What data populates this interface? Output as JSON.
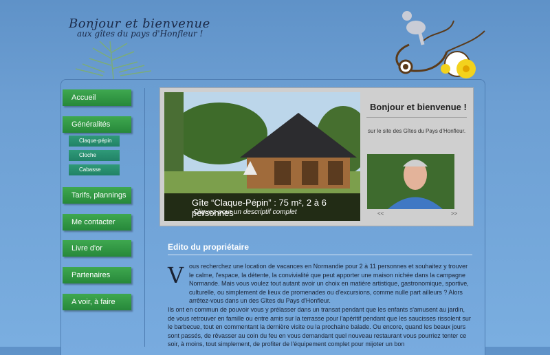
{
  "header": {
    "welcome_line1": "Bonjour et bienvenue",
    "welcome_line2": "aux gîtes du pays d'Honfleur !"
  },
  "nav": {
    "accueil": "Accueil",
    "generalites": "Généralités",
    "sub_items": [
      "Claque-pépin",
      "Cloche",
      "Cabasse"
    ],
    "tarifs": "Tarifs, plannings",
    "contact": "Me contacter",
    "livre": "Livre d'or",
    "partenaires": "Partenaires",
    "voir": "A voir, à faire"
  },
  "slider": {
    "caption_title": "Gîte “Claque-Pépin” : 75 m², 2 à 6 personnes",
    "caption_sub": "Cliquez pour un descriptif complet",
    "side_title": "Bonjour et bienvenue !",
    "side_text": "sur le site des Gîtes du Pays d'Honfleur.",
    "prev": "<<",
    "next": ">>"
  },
  "edito": {
    "title": "Edito du propriétaire",
    "drop_cap": "V",
    "para1": "ous recherchez une location de vacances en Normandie pour 2 à 11 personnes et souhaitez y trouver le calme, l'espace, la détente, la convivialité que peut apporter une maison nichée dans la campagne Normande. Mais vous voulez tout autant avoir un choix en matière artistique, gastronomique, sportive, culturelle, ou simplement de lieux de promenades ou d'excursions, comme nulle part ailleurs ? Alors arrêtez-vous dans un des Gîtes du Pays d'Honfleur.",
    "para2": "Ils ont en commun de pouvoir vous y prélasser dans un transat pendant que les enfants s'amusent au jardin, de vous retrouver en famille ou entre amis sur la terrasse pour l'apéritif pendant que les saucisses rissolent sur le barbecue, tout en commentant la dernière visite ou la prochaine balade. Ou encore, quand les beaux jours sont passés, de rêvasser au coin du feu en vous demandant quel nouveau restaurant vous pourriez tenter ce soir, à moins, tout simplement, de profiter de l'équipement complet pour mijoter un bon"
  }
}
